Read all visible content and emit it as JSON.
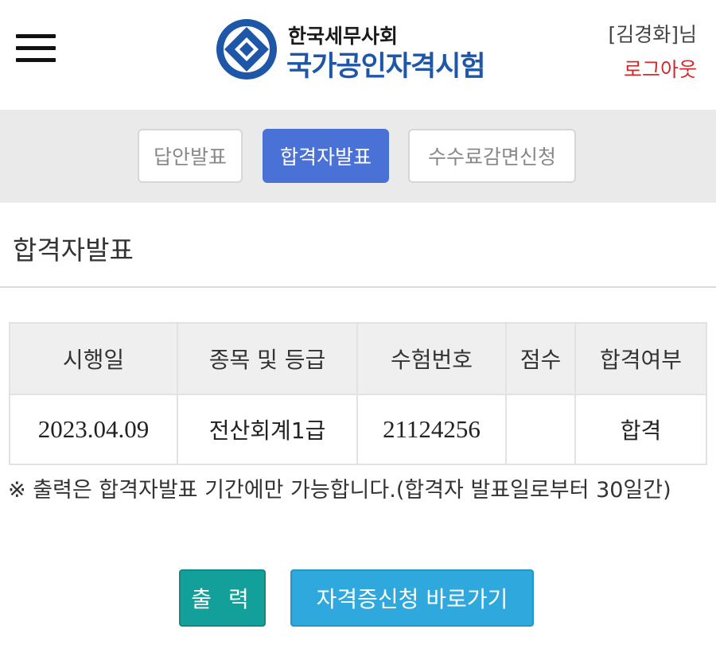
{
  "header": {
    "logo_line1": "한국세무사회",
    "logo_line2": "국가공인자격시험",
    "user_name": "[김경화]님",
    "logout_label": "로그아웃"
  },
  "tabs": [
    {
      "label": "답안발표",
      "active": false
    },
    {
      "label": "합격자발표",
      "active": true
    },
    {
      "label": "수수료감면신청",
      "active": false
    }
  ],
  "page_title": "합격자발표",
  "table": {
    "columns": [
      "시행일",
      "종목 및 등급",
      "수험번호",
      "점수",
      "합격여부"
    ],
    "rows": [
      {
        "date": "2023.04.09",
        "subject": "전산회계1급",
        "exam_number": "21124256",
        "score": "",
        "result": "합격"
      }
    ]
  },
  "notice": "※ 출력은 합격자발표 기간에만 가능합니다.(합격자 발표일로부터 30일간)",
  "buttons": {
    "print_label": "출 력",
    "apply_label": "자격증신청 바로가기"
  },
  "colors": {
    "brand_blue": "#1f57a8",
    "active_tab": "#4a72d6",
    "logout_red": "#d22a2a",
    "print_button": "#13a09a",
    "apply_button": "#2ea8dd"
  }
}
